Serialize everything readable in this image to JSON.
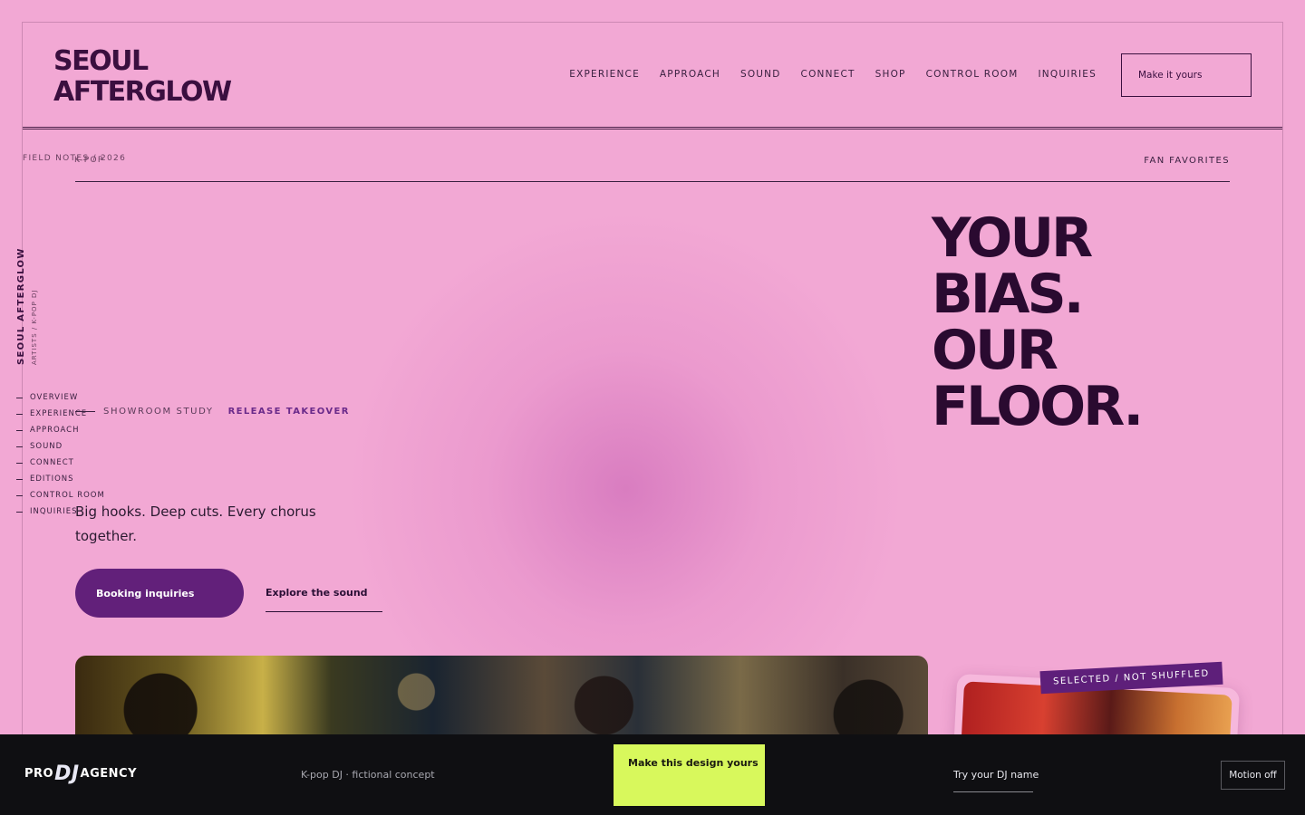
{
  "brand": {
    "line1": "SEOUL",
    "line2": "AFTERGLOW"
  },
  "nav": {
    "items": [
      "EXPERIENCE",
      "APPROACH",
      "SOUND",
      "CONNECT",
      "SHOP",
      "CONTROL ROOM",
      "INQUIRIES"
    ],
    "cta": "Make it yours"
  },
  "subbar": {
    "field_notes": "FIELD NOTES / 2026",
    "genre": "K-POP",
    "fan_favorites": "FAN FAVORITES"
  },
  "side": {
    "brand": "SEOUL AFTERGLOW",
    "sub": "ARTISTS / K-POP DJ",
    "items": [
      "OVERVIEW",
      "EXPERIENCE",
      "APPROACH",
      "SOUND",
      "CONNECT",
      "EDITIONS",
      "CONTROL ROOM",
      "INQUIRIES"
    ]
  },
  "hero": {
    "tag1": "SHOWROOM STUDY",
    "tag2": "RELEASE TAKEOVER",
    "headline": [
      "YOUR",
      "BIAS.",
      "OUR",
      "FLOOR."
    ],
    "lede": "Big hooks. Deep cuts. Every chorus together.",
    "primary_cta": "Booking inquiries",
    "secondary_cta": "Explore the sound",
    "badge": "SELECTED / NOT SHUFFLED"
  },
  "bottombar": {
    "logo_pre": "PRO",
    "logo_mid": "DJ",
    "logo_post": "AGENCY",
    "concept": "K-pop DJ · fictional concept",
    "lime_cta": "Make this design yours",
    "dj_name": "Try your DJ name",
    "motion": "Motion off"
  },
  "colors": {
    "background": "#f2a8d4",
    "primary": "#62207a",
    "lime": "#d8f85c",
    "bar": "#0f0f12"
  }
}
